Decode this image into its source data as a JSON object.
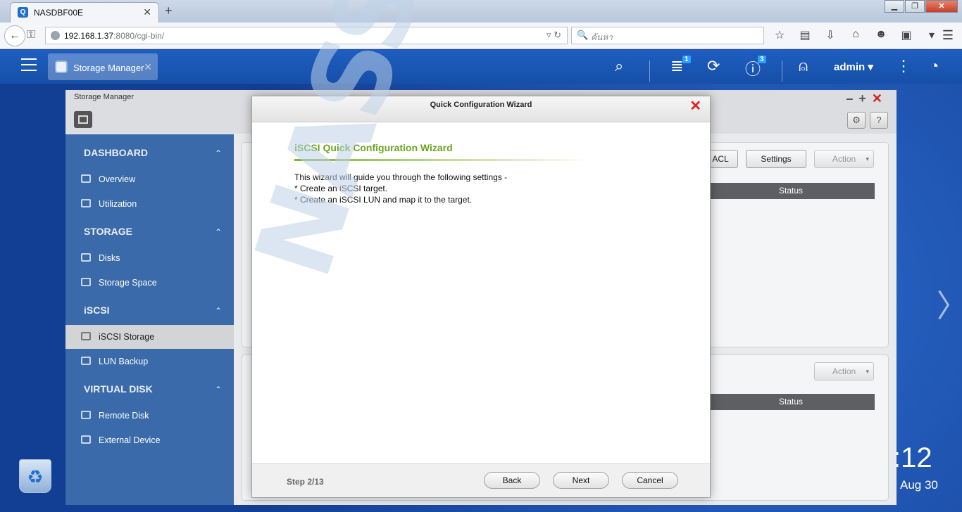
{
  "browser": {
    "tab_title": "NASDBF00E",
    "url_host": "192.168.1.37",
    "url_rest": ":8080/cgi-bin/",
    "search_placeholder": "ค้นหา"
  },
  "topbar": {
    "task_label": "Storage Manager",
    "tasks_badge": "1",
    "info_badge": "3",
    "user": "admin ▾"
  },
  "window": {
    "title": "Storage Manager",
    "sidebar": {
      "sections": [
        {
          "label": "DASHBOARD",
          "items": [
            "Overview",
            "Utilization"
          ]
        },
        {
          "label": "STORAGE",
          "items": [
            "Disks",
            "Storage Space"
          ]
        },
        {
          "label": "iSCSI",
          "items": [
            "iSCSI Storage",
            "LUN Backup"
          ]
        },
        {
          "label": "VIRTUAL DISK",
          "items": [
            "Remote Disk",
            "External Device"
          ]
        }
      ]
    },
    "panel1": {
      "acl": "ACL",
      "settings": "Settings",
      "action": "Action",
      "status_header": "Status"
    },
    "panel2": {
      "action": "Action",
      "status_header": "Status"
    }
  },
  "modal": {
    "title": "Quick Configuration Wizard",
    "heading": "iSCSI Quick Configuration Wizard",
    "lines": [
      "This wizard will guide you through the following settings -",
      "* Create an iSCSI target.",
      "* Create an iSCSI LUN and map it to the target."
    ],
    "step": "Step 2/13",
    "back": "Back",
    "next": "Next",
    "cancel": "Cancel"
  },
  "desktop": {
    "clock": ":12",
    "date": "Aug 30"
  },
  "watermark": "NASSHOPS.net"
}
